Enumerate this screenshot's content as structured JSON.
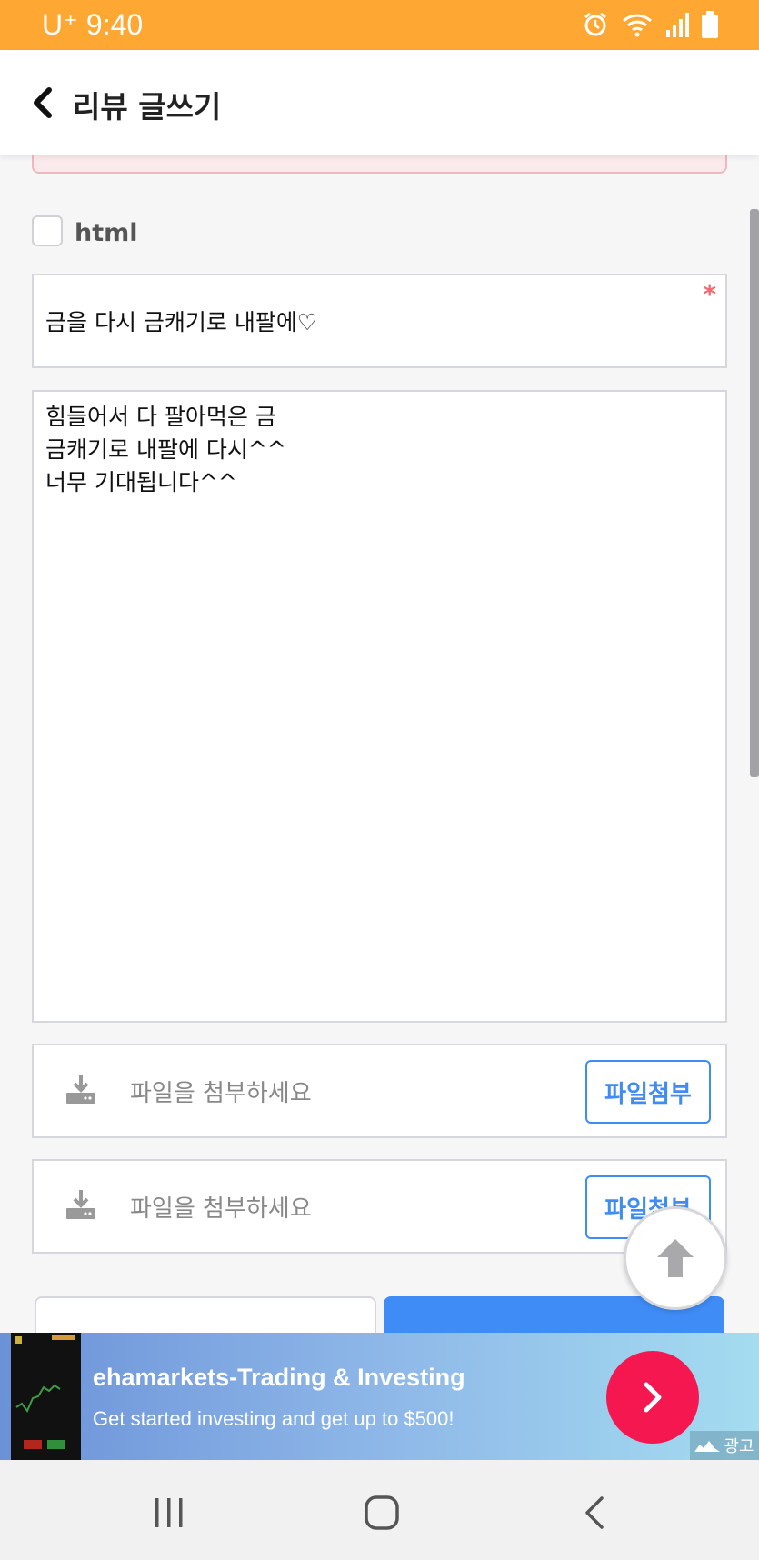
{
  "status_bar": {
    "carrier_time": "U⁺ 9:40",
    "icons": [
      "alarm-icon",
      "wifi-icon",
      "signal-icon",
      "battery-icon"
    ]
  },
  "header": {
    "title": "리뷰 글쓰기"
  },
  "form": {
    "html_option_label": "html",
    "subject_value": "금을 다시 금캐기로 내팔에♡",
    "required_mark": "*",
    "body_lines": [
      "힘들어서 다 팔아먹은 금",
      "금캐기로 내팔에 다시^^",
      "너무 기대됩니다^^"
    ],
    "file_inputs": [
      {
        "placeholder": "파일을 첨부하세요",
        "button_label": "파일첨부"
      },
      {
        "placeholder": "파일을 첨부하세요",
        "button_label": "파일첨부"
      }
    ]
  },
  "ad": {
    "title": "ehamarkets-Trading & Investing",
    "subtitle": "Get started investing and get up to $500!",
    "badge": "광고"
  },
  "colors": {
    "status_bar": "#ffa733",
    "accent_blue": "#3f8cf7",
    "ad_cta": "#f5174f"
  }
}
